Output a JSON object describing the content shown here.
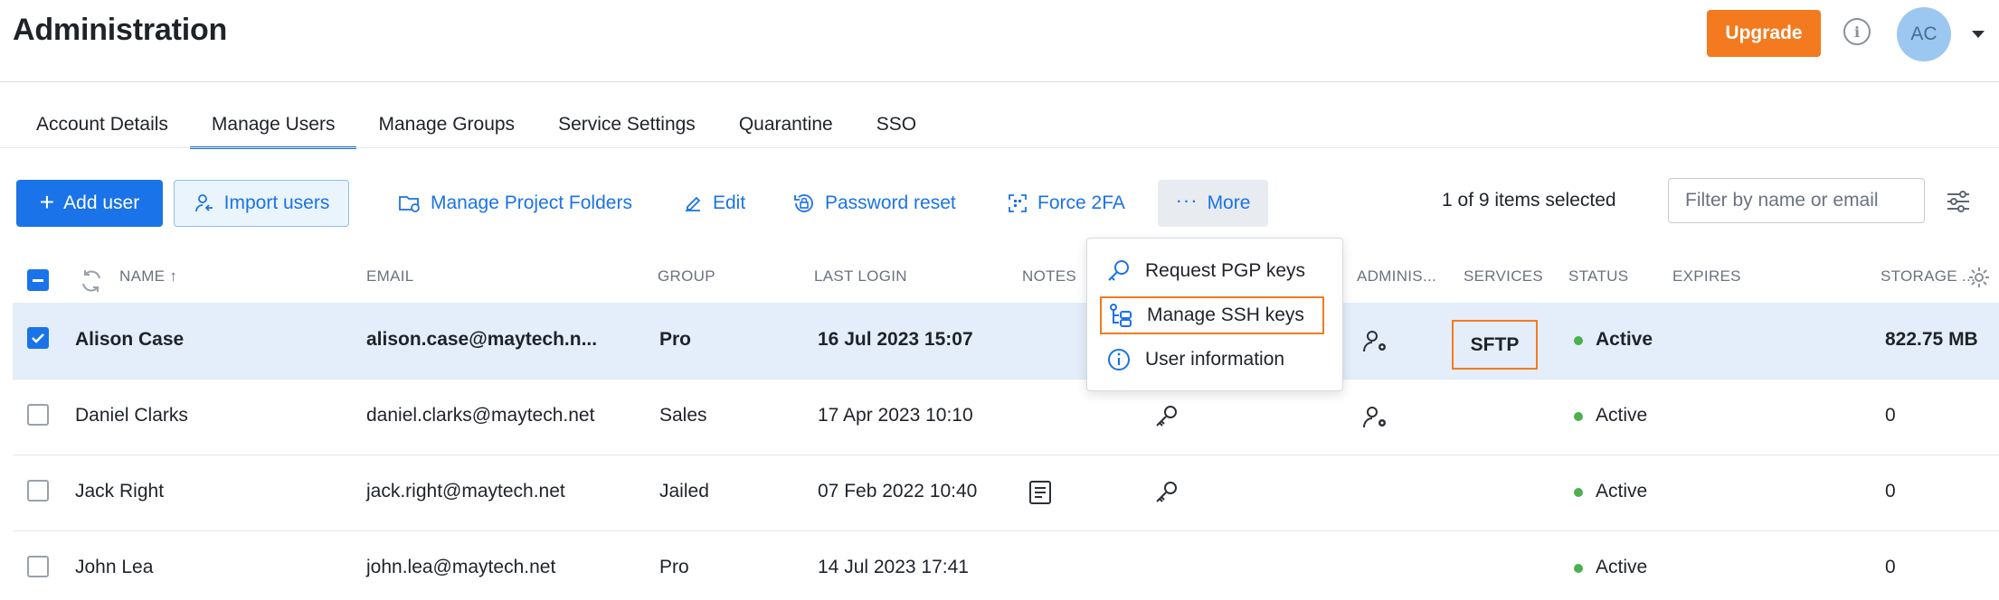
{
  "header": {
    "title": "Administration",
    "upgrade_label": "Upgrade",
    "avatar_initials": "AC",
    "accent_color": "#f47a1f"
  },
  "tabs": [
    {
      "label": "Account Details",
      "active": false
    },
    {
      "label": "Manage Users",
      "active": true
    },
    {
      "label": "Manage Groups",
      "active": false
    },
    {
      "label": "Service Settings",
      "active": false
    },
    {
      "label": "Quarantine",
      "active": false
    },
    {
      "label": "SSO",
      "active": false
    }
  ],
  "toolbar": {
    "add_user": "Add user",
    "import_users": "Import users",
    "manage_project_folders": "Manage Project Folders",
    "edit": "Edit",
    "password_reset": "Password reset",
    "force_2fa": "Force 2FA",
    "more": "More",
    "selected_count": "1 of 9 items selected",
    "filter_placeholder": "Filter by name or email",
    "primary_color": "#1a73e8"
  },
  "dropdown": {
    "items": [
      {
        "label": "Request PGP keys",
        "icon": "key-search-icon"
      },
      {
        "label": "Manage SSH keys",
        "icon": "ssh-keys-icon",
        "highlighted": true
      },
      {
        "label": "User information",
        "icon": "info-icon"
      }
    ]
  },
  "table": {
    "columns": {
      "name": "NAME",
      "email": "EMAIL",
      "group": "GROUP",
      "last_login": "LAST LOGIN",
      "notes": "NOTES",
      "admin": "ADMINIS...",
      "services": "SERVICES",
      "status": "STATUS",
      "expires": "EXPIRES",
      "storage": "STORAGE ..."
    },
    "rows": [
      {
        "name": "Alison Case",
        "email": "alison.case@maytech.n...",
        "group": "Pro",
        "last_login": "16 Jul 2023 15:07",
        "services": "SFTP",
        "status": "Active",
        "storage": "822.75 MB",
        "selected": true
      },
      {
        "name": "Daniel Clarks",
        "email": "daniel.clarks@maytech.net",
        "group": "Sales",
        "last_login": "17 Apr 2023 10:10",
        "services": "",
        "status": "Active",
        "storage": "0",
        "selected": false
      },
      {
        "name": "Jack Right",
        "email": "jack.right@maytech.net",
        "group": "Jailed",
        "last_login": "07 Feb 2022 10:40",
        "services": "",
        "status": "Active",
        "storage": "0",
        "selected": false
      },
      {
        "name": "John Lea",
        "email": "john.lea@maytech.net",
        "group": "Pro",
        "last_login": "14 Jul 2023 17:41",
        "services": "",
        "status": "Active",
        "storage": "0",
        "selected": false
      }
    ]
  }
}
